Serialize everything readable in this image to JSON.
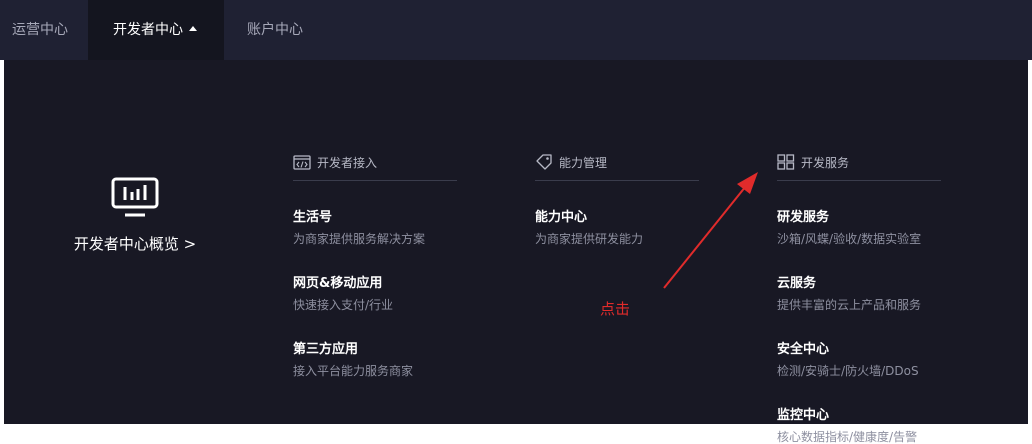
{
  "topnav": {
    "items": [
      {
        "label": "运营中心"
      },
      {
        "label": "开发者中心"
      },
      {
        "label": "账户中心"
      }
    ]
  },
  "overview": {
    "icon": "monitor-chart-icon",
    "label": "开发者中心概览 >"
  },
  "columns": [
    {
      "icon": "code-window-icon",
      "title": "开发者接入",
      "items": [
        {
          "name": "生活号",
          "desc": "为商家提供服务解决方案"
        },
        {
          "name": "网页&移动应用",
          "desc": "快速接入支付/行业"
        },
        {
          "name": "第三方应用",
          "desc": "接入平台能力服务商家"
        }
      ]
    },
    {
      "icon": "tag-icon",
      "title": "能力管理",
      "items": [
        {
          "name": "能力中心",
          "desc": "为商家提供研发能力"
        }
      ]
    },
    {
      "icon": "grid-icon",
      "title": "开发服务",
      "items": [
        {
          "name": "研发服务",
          "desc": "沙箱/风蝶/验收/数据实验室"
        },
        {
          "name": "云服务",
          "desc": "提供丰富的云上产品和服务"
        },
        {
          "name": "安全中心",
          "desc": "检测/安骑士/防火墙/DDoS"
        },
        {
          "name": "监控中心",
          "desc": "核心数据指标/健康度/告警"
        }
      ]
    }
  ],
  "annotation": {
    "text": "点击",
    "color": "#e02b2b"
  },
  "colors": {
    "nav_bg": "#1f2133",
    "nav_active_bg": "#14151f",
    "panel_bg": "#181824"
  }
}
